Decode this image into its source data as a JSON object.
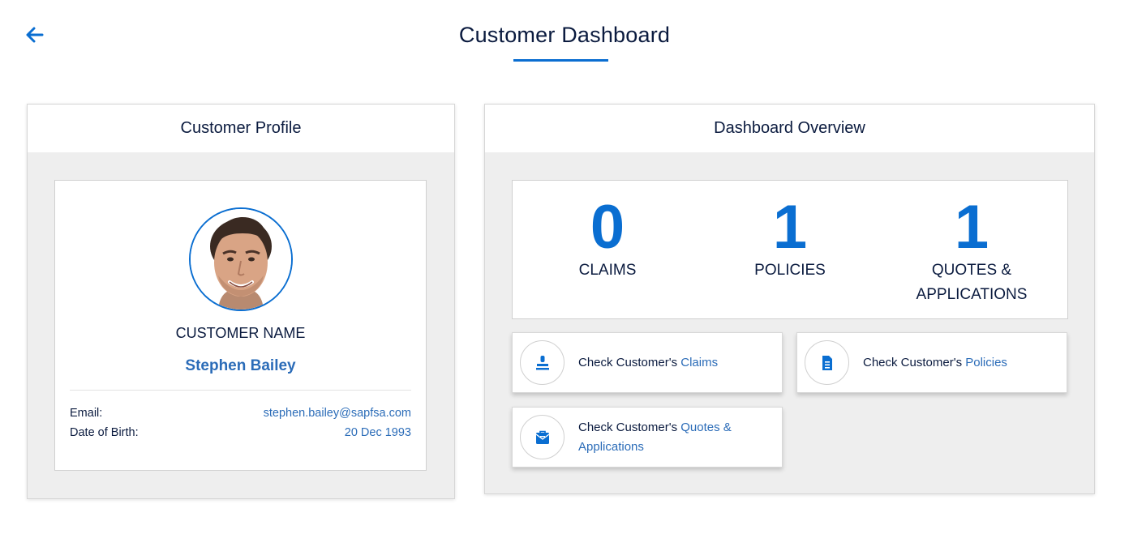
{
  "header": {
    "title": "Customer Dashboard"
  },
  "profile": {
    "card_title": "Customer Profile",
    "name_label": "CUSTOMER NAME",
    "name": "Stephen Bailey",
    "email_label": "Email:",
    "email": "stephen.bailey@sapfsa.com",
    "dob_label": "Date of Birth:",
    "dob": "20 Dec 1993"
  },
  "overview": {
    "card_title": "Dashboard Overview",
    "stats": [
      {
        "value": "0",
        "label": "CLAIMS"
      },
      {
        "value": "1",
        "label": "POLICIES"
      },
      {
        "value": "1",
        "label_line1": "QUOTES &",
        "label_line2": "APPLICATIONS"
      }
    ],
    "actions": [
      {
        "prefix": "Check Customer's ",
        "link": "Claims",
        "icon": "stamp-icon"
      },
      {
        "prefix": "Check Customer's ",
        "link": "Policies",
        "icon": "document-icon"
      },
      {
        "prefix": "Check Customer's ",
        "link": "Quotes &",
        "link_line2": "Applications",
        "icon": "envelope-briefcase-icon"
      }
    ]
  },
  "colors": {
    "accent": "#0a6ed1",
    "link": "#2b6cb8",
    "text": "#0b1b3f",
    "panel_bg": "#eeeeee"
  }
}
